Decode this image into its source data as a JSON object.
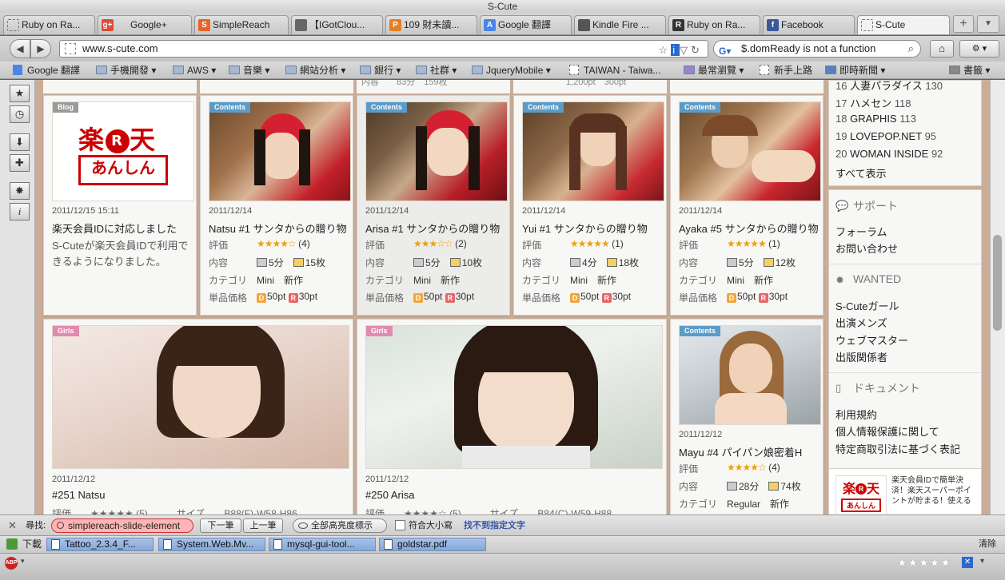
{
  "window": {
    "title": "S-Cute"
  },
  "tabs": [
    {
      "label": "Ruby on Ra...",
      "fav": "",
      "color": "#dddddd"
    },
    {
      "label": "Google+",
      "fav": "g+",
      "color": "#dd4b39"
    },
    {
      "label": "SimpleReach",
      "fav": "S",
      "color": "#e8632b"
    },
    {
      "label": "【IGotClou...",
      "fav": "",
      "color": "#666666"
    },
    {
      "label": "109 財未讀...",
      "fav": "P",
      "color": "#e67e22"
    },
    {
      "label": "Google 翻譯",
      "fav": "A",
      "color": "#4a86e8"
    },
    {
      "label": "Kindle Fire ...",
      "fav": "",
      "color": "#555555"
    },
    {
      "label": "Ruby on Ra...",
      "fav": "R",
      "color": "#333333"
    },
    {
      "label": "Facebook",
      "fav": "f",
      "color": "#3b5998"
    },
    {
      "label": "S-Cute",
      "fav": "",
      "color": "#ffffff"
    }
  ],
  "nav": {
    "url": "www.s-cute.com",
    "search_text": "$.domReady is not a function"
  },
  "bookmarks": [
    {
      "label": "Google 翻譯",
      "type": "page"
    },
    {
      "label": "手機開發 ▾",
      "type": "folder"
    },
    {
      "label": "AWS ▾",
      "type": "folder"
    },
    {
      "label": "音樂 ▾",
      "type": "folder"
    },
    {
      "label": "網站分析 ▾",
      "type": "folder"
    },
    {
      "label": "銀行 ▾",
      "type": "folder"
    },
    {
      "label": "社群 ▾",
      "type": "folder"
    },
    {
      "label": "JqueryMobile ▾",
      "type": "folder"
    },
    {
      "label": "TAIWAN - Taiwa...",
      "type": "page"
    },
    {
      "label": "最常瀏覽 ▾",
      "type": "folder"
    },
    {
      "label": "新手上路",
      "type": "page"
    },
    {
      "label": "即時新聞 ▾",
      "type": "folder"
    },
    {
      "label": "書籤 ▾",
      "type": "folder"
    }
  ],
  "cards_row1": [
    {
      "badge": "Blog",
      "date": "2011/12/15 15:11",
      "title": "楽天会員IDに対応しました",
      "desc1": "S-Cuteが楽天会員IDで利用で",
      "desc2": "きるようになりました。"
    },
    {
      "badge": "Contents",
      "date": "2011/12/14",
      "title": "Natsu #1 サンタからの贈り物",
      "stars": "★★★★☆",
      "rating": "(4)",
      "duration": "5分",
      "photos": "15枚",
      "category": "Mini",
      "tag": "新作",
      "price_d": "50pt",
      "price_r": "30pt"
    },
    {
      "badge": "Contents",
      "date": "2011/12/14",
      "title": "Arisa #1 サンタからの贈り物",
      "stars": "★★★☆☆",
      "rating": "(2)",
      "duration": "5分",
      "photos": "10枚",
      "category": "Mini",
      "tag": "新作",
      "price_d": "50pt",
      "price_r": "30pt"
    },
    {
      "badge": "Contents",
      "date": "2011/12/14",
      "title": "Yui #1 サンタからの贈り物",
      "stars": "★★★★★",
      "rating": "(1)",
      "duration": "4分",
      "photos": "18枚",
      "category": "Mini",
      "tag": "新作",
      "price_d": "50pt",
      "price_r": "30pt"
    },
    {
      "badge": "Contents",
      "date": "2011/12/14",
      "title": "Ayaka #5 サンタからの贈り物",
      "stars": "★★★★★",
      "rating": "(1)",
      "duration": "5分",
      "photos": "12枚",
      "category": "Mini",
      "tag": "新作",
      "price_d": "50pt",
      "price_r": "30pt"
    }
  ],
  "cards_row2": [
    {
      "badge": "Girls",
      "date": "2011/12/12",
      "title": "#251 Natsu",
      "partial": "評価　　★★★★★ (5)　　　サイズ　　B88(F)-W58-H86"
    },
    {
      "badge": "Girls",
      "date": "2011/12/12",
      "title": "#250 Arisa",
      "partial": "評価　　★★★★☆ (5)　　　サイズ　　B84(C)-W59-H88"
    },
    {
      "badge": "Contents",
      "date": "2011/12/12",
      "title": "Mayu #4 パイパン娘密着H",
      "stars": "★★★★☆",
      "rating": "(4)",
      "duration": "28分",
      "photos": "74枚",
      "category": "Regular",
      "tag": "新作"
    }
  ],
  "labels": {
    "rating": "評価",
    "content": "内容",
    "category": "カテゴリ",
    "price": "単品価格"
  },
  "top_sliver": {
    "a": "内容　　83分　159枚",
    "b": "1,200pt　300pt"
  },
  "sidebar": {
    "ranking": [
      {
        "rank": "16",
        "name": "人妻パラダイス",
        "count": "130"
      },
      {
        "rank": "17",
        "name": "ハメセン",
        "count": "118"
      },
      {
        "rank": "18",
        "name": "GRAPHIS",
        "count": "113"
      },
      {
        "rank": "19",
        "name": "LOVEPOP.NET",
        "count": "95"
      },
      {
        "rank": "20",
        "name": "WOMAN INSIDE",
        "count": "92"
      }
    ],
    "show_all": "すべて表示",
    "support": {
      "heading": "サポート",
      "items": [
        "フォーラム",
        "お問い合わせ"
      ]
    },
    "wanted": {
      "heading": "WANTED",
      "items": [
        "S-Cuteガール",
        "出演メンズ",
        "ウェブマスター",
        "出版関係者"
      ]
    },
    "docs": {
      "heading": "ドキュメント",
      "items": [
        "利用規約",
        "個人情報保護に関して",
        "特定商取引法に基づく表記"
      ]
    },
    "ad_text": "楽天会員IDで簡単決済！楽天スーパーポイントが貯まる！使える"
  },
  "findbar": {
    "label": "尋找:",
    "query": "simplereach-slide-element",
    "next": "下一筆",
    "prev": "上一筆",
    "highlight": "全部高亮度標示",
    "match_case": "符合大小寫",
    "not_found": "找不到指定文字"
  },
  "downloads": {
    "label": "下載",
    "items": [
      "Tattoo_2.3.4_F...",
      "System.Web.Mv...",
      "mysql-gui-tool...",
      "goldstar.pdf"
    ],
    "clear": "清除"
  },
  "status": {
    "abp": "ABP",
    "stars": "★★★★★"
  }
}
